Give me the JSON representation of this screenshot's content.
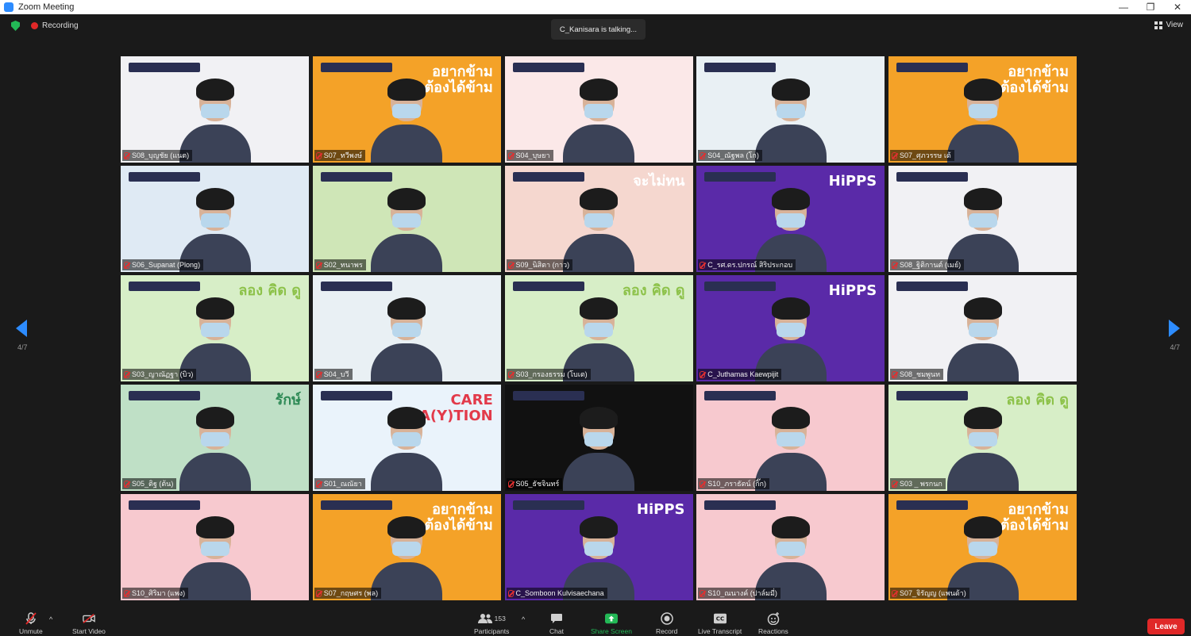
{
  "window": {
    "title": "Zoom Meeting",
    "controls": [
      "—",
      "❐",
      "✕"
    ]
  },
  "top": {
    "recording_label": "Recording",
    "talking_text": "C_Kanisara is talking...",
    "view_label": "View"
  },
  "pagination": {
    "left": "4/7",
    "right": "4/7"
  },
  "tiles": [
    {
      "name": "S08_บุญชัย (แนต)",
      "bg": "#f1f1f4",
      "headline": "",
      "accent": "#7b55a8"
    },
    {
      "name": "S07_ทวีพงษ์",
      "bg": "#f4a228",
      "headline": "อยากข้าม\nต้องได้ข้าม",
      "accent": "#f4a228"
    },
    {
      "name": "S04_บุษยา",
      "bg": "#fbe8e8",
      "headline": "",
      "accent": "#f08aa0"
    },
    {
      "name": "S04_ณัฐพล (โก)",
      "bg": "#e9f0f4",
      "headline": "",
      "accent": "#f08aa0"
    },
    {
      "name": "S07_ศุภวรรษ เต้",
      "bg": "#f4a228",
      "headline": "อยากข้าม\nต้องได้ข้าม",
      "accent": "#f4a228"
    },
    {
      "name": "S06_Supanat (Plong)",
      "bg": "#dfeaf4",
      "headline": "",
      "accent": "#2a5fa8"
    },
    {
      "name": "S02_ทนาพร",
      "bg": "#cfe6b7",
      "headline": "",
      "accent": "#2a5fa8"
    },
    {
      "name": "S09_นิสิตา (กาว)",
      "bg": "#f5d7cf",
      "headline": "จะไม่ทน",
      "accent": "#d8b298"
    },
    {
      "name": "C_รศ.ดร.ปกรณ์ สิริประกอบ",
      "bg": "#5a2aa8",
      "headline": "HiPPS",
      "accent": "#7b2bd0"
    },
    {
      "name": "S08_ฐิติกานต์ (เมย์)",
      "bg": "#f1f1f4",
      "headline": "",
      "accent": "#7b55a8"
    },
    {
      "name": "S03_ญาณัฏฐา (บิว)",
      "bg": "#d7eec7",
      "headline": "ลอง คิด ดู",
      "accent": "#8dc24a"
    },
    {
      "name": "S04_บวี",
      "bg": "#e9f0f4",
      "headline": "",
      "accent": "#f08aa0"
    },
    {
      "name": "S03_กรองธรรม (โบเต)",
      "bg": "#d7eec7",
      "headline": "ลอง คิด ดู",
      "accent": "#8dc24a"
    },
    {
      "name": "C_Juthamas Kaewpijit",
      "bg": "#5a2aa8",
      "headline": "HiPPS",
      "accent": "#7b2bd0"
    },
    {
      "name": "S08_ชมพูนท",
      "bg": "#f1f1f4",
      "headline": "",
      "accent": "#7b55a8"
    },
    {
      "name": "S05_ติฐ (ต้น)",
      "bg": "#bfe0c6",
      "headline": "รักษ์",
      "accent": "#2e8a56"
    },
    {
      "name": "S01_ณณัยา",
      "bg": "#eaf3fb",
      "headline": "CARE\nSTA(Y)TION",
      "accent": "#e23a4a"
    },
    {
      "name": "S05_ธัชจินทร์",
      "bg": "#111111",
      "headline": "",
      "accent": "#6a2ad0"
    },
    {
      "name": "S10_ภราธัตน์ (กิ๊ก)",
      "bg": "#f7c9cf",
      "headline": "",
      "accent": "#ffffff"
    },
    {
      "name": "S03 _ พรกนก",
      "bg": "#d7eec7",
      "headline": "ลอง คิด ดู",
      "accent": "#8dc24a"
    },
    {
      "name": "S10_ศิริมา (แพง)",
      "bg": "#f7c9cf",
      "headline": "",
      "accent": "#ffffff"
    },
    {
      "name": "S07_กฤษศร (พล)",
      "bg": "#f4a228",
      "headline": "อยากข้าม\nต้องได้ข้าม",
      "accent": "#f4a228"
    },
    {
      "name": "C_Somboon Kulvisaechana",
      "bg": "#5a2aa8",
      "headline": "HiPPS",
      "accent": "#7b2bd0"
    },
    {
      "name": "S10_ณนางค์ (ปาล์มมี่)",
      "bg": "#f7c9cf",
      "headline": "",
      "accent": "#ffffff"
    },
    {
      "name": "S07_จิรัญญ (แพนด้า)",
      "bg": "#f4a228",
      "headline": "อยากข้าม\nต้องได้ข้าม",
      "accent": "#f4a228"
    }
  ],
  "toolbar": {
    "unmute": "Unmute",
    "start_video": "Start Video",
    "participants": "Participants",
    "participants_count": "153",
    "chat": "Chat",
    "share_screen": "Share Screen",
    "record": "Record",
    "live_transcript": "Live Transcript",
    "reactions": "Reactions",
    "leave": "Leave"
  },
  "colors": {
    "accent": "#2d8cff",
    "danger": "#e02828",
    "share": "#23b856"
  }
}
